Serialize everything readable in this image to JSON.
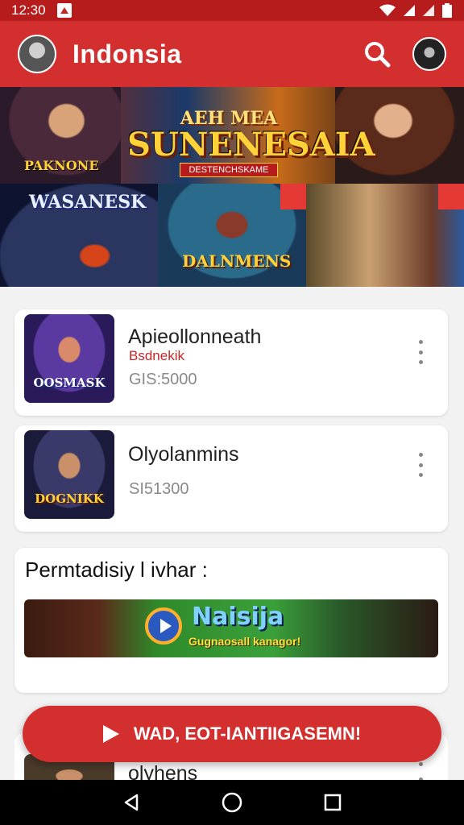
{
  "status_bar": {
    "time": "12:30",
    "icons": [
      "notification-icon",
      "wifi-icon",
      "signal-icon",
      "signal-icon",
      "battery-icon"
    ]
  },
  "app_bar": {
    "title": "Indonsia",
    "icons": [
      "avatar",
      "search-icon",
      "profile-avatar"
    ]
  },
  "hero_banner": {
    "small_title": "AEH MEA",
    "big_title": "SUNENESAIA",
    "ribbon": "DESTENCHSKAME",
    "left_caption": "PAKNONE"
  },
  "tiles": [
    {
      "label": "WASANESK"
    },
    {
      "label": "DALNMENS"
    },
    {
      "label": ""
    }
  ],
  "list": [
    {
      "thumb_title": "OOSMASK",
      "name": "Apieollonneath",
      "tag": "Bsdnekik",
      "price": "GIS:5000"
    },
    {
      "thumb_title": "DOGNIKK",
      "name": "Olyolanmins",
      "tag": "",
      "price": "SI51300"
    }
  ],
  "section": {
    "heading": "Permtadisiy l ivhar :",
    "banner_title": "Naisija",
    "banner_subtitle": "Gugnaosall kanagor!"
  },
  "peek_item": {
    "name": "olyhens"
  },
  "fab": {
    "label": "WAD, EOT-IANTIIGASEMN!"
  },
  "colors": {
    "primary": "#d32f2f",
    "status_bar": "#b71c1c",
    "accent_tag": "#c62828"
  }
}
